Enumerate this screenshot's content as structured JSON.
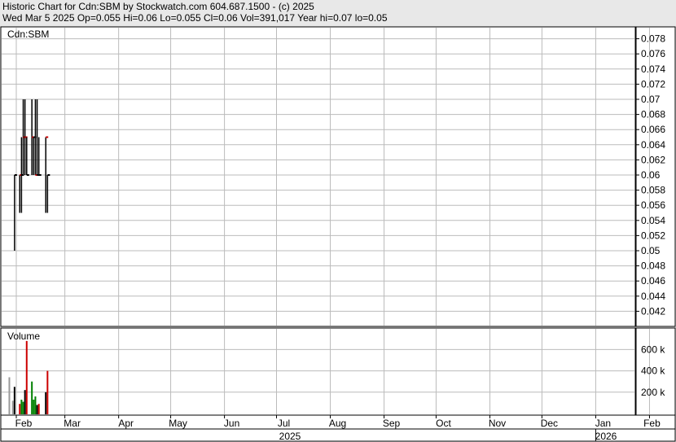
{
  "header": {
    "line1": "Historic Chart for Cdn:SBM by Stockwatch.com 604.687.1500 - (c) 2025",
    "line2": "Wed Mar  5 2025  Op=0.055  Hi=0.06  Lo=0.055  Cl=0.06  Vol=391,017  Year hi=0.07  lo=0.05"
  },
  "chart_data": [
    {
      "type": "ohlc",
      "title": "Cdn:SBM",
      "ylim": [
        0.04,
        0.08
      ],
      "y_ticks": [
        "0.078",
        "0.076",
        "0.074",
        "0.072",
        "0.07",
        "0.068",
        "0.066",
        "0.064",
        "0.062",
        "0.06",
        "0.058",
        "0.056",
        "0.054",
        "0.052",
        "0.05",
        "0.048",
        "0.046",
        "0.044",
        "0.042"
      ],
      "x_labels": [
        "Feb",
        "Mar",
        "Apr",
        "May",
        "Jun",
        "Jul",
        "Aug",
        "Sep",
        "Oct",
        "Nov",
        "Dec",
        "Jan",
        "Feb"
      ],
      "year_labels": [
        "2025",
        "2026"
      ],
      "grid": true,
      "up_color": "#008000",
      "down_color": "#cc0000",
      "bars": [
        {
          "d": "2025-01-31",
          "lo": 0.05,
          "hi": 0.06,
          "cl": 0.06,
          "c": "black"
        },
        {
          "d": "2025-02-03",
          "lo": 0.055,
          "hi": 0.06,
          "cl": 0.06,
          "c": "red"
        },
        {
          "d": "2025-02-04",
          "lo": 0.055,
          "hi": 0.065,
          "cl": 0.06,
          "c": "black"
        },
        {
          "d": "2025-02-05",
          "lo": 0.06,
          "hi": 0.07,
          "cl": 0.065,
          "c": "red"
        },
        {
          "d": "2025-02-06",
          "lo": 0.06,
          "hi": 0.07,
          "cl": 0.065,
          "c": "red"
        },
        {
          "d": "2025-02-07",
          "lo": 0.06,
          "hi": 0.065,
          "cl": 0.06,
          "c": "black"
        },
        {
          "d": "2025-02-10",
          "lo": 0.06,
          "hi": 0.07,
          "cl": 0.065,
          "c": "red"
        },
        {
          "d": "2025-02-11",
          "lo": 0.06,
          "hi": 0.065,
          "cl": 0.065,
          "c": "black"
        },
        {
          "d": "2025-02-12",
          "lo": 0.06,
          "hi": 0.07,
          "cl": 0.06,
          "c": "red"
        },
        {
          "d": "2025-02-13",
          "lo": 0.06,
          "hi": 0.07,
          "cl": 0.06,
          "c": "black"
        },
        {
          "d": "2025-02-14",
          "lo": 0.06,
          "hi": 0.065,
          "cl": 0.06,
          "c": "black"
        },
        {
          "d": "2025-02-18",
          "lo": 0.055,
          "hi": 0.065,
          "cl": 0.065,
          "c": "red"
        },
        {
          "d": "2025-02-19",
          "lo": 0.055,
          "hi": 0.06,
          "cl": 0.06,
          "c": "black"
        }
      ]
    },
    {
      "type": "bar",
      "title": "Volume",
      "ylim": [
        0,
        800000
      ],
      "y_ticks": [
        "600 k",
        "400 k",
        "200 k"
      ],
      "bars": [
        {
          "d": "2025-01-28",
          "v": 340000,
          "c": "#999999"
        },
        {
          "d": "2025-01-30",
          "v": 120000,
          "c": "#999999"
        },
        {
          "d": "2025-01-31",
          "v": 250000,
          "c": "black"
        },
        {
          "d": "2025-02-03",
          "v": 90000,
          "c": "red"
        },
        {
          "d": "2025-02-04",
          "v": 130000,
          "c": "green"
        },
        {
          "d": "2025-02-05",
          "v": 110000,
          "c": "green"
        },
        {
          "d": "2025-02-06",
          "v": 220000,
          "c": "black"
        },
        {
          "d": "2025-02-07",
          "v": 680000,
          "c": "red"
        },
        {
          "d": "2025-02-10",
          "v": 300000,
          "c": "green"
        },
        {
          "d": "2025-02-11",
          "v": 130000,
          "c": "green"
        },
        {
          "d": "2025-02-12",
          "v": 160000,
          "c": "green"
        },
        {
          "d": "2025-02-13",
          "v": 80000,
          "c": "black"
        },
        {
          "d": "2025-02-14",
          "v": 90000,
          "c": "red"
        },
        {
          "d": "2025-02-18",
          "v": 200000,
          "c": "black"
        },
        {
          "d": "2025-02-19",
          "v": 400000,
          "c": "red"
        }
      ]
    }
  ]
}
